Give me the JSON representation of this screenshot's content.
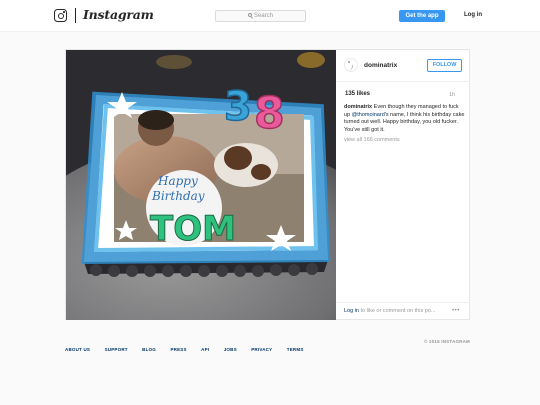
{
  "header": {
    "logo_icon": "instagram-camera-icon",
    "wordmark": "Instagram",
    "search_placeholder": "Search",
    "get_app_label": "Get the app",
    "login_label": "Log in"
  },
  "post": {
    "photo": {
      "description_icon": "photo",
      "cake_text_line1": "Happy",
      "cake_text_line2": "Birthday",
      "cake_name": "TOM",
      "candle_digits": [
        "3",
        "8"
      ]
    },
    "author": "dominatrix",
    "follow_label": "FOLLOW",
    "likes": "135 likes",
    "age": "1h",
    "caption": {
      "author": "dominatrix",
      "text_before": " Even though they managed to fuck up ",
      "mention": "@thomoinard",
      "text_after": "'s name, I think his birthday cake turned out well. Happy birthday, you old fucker. You've still got it."
    },
    "view_all_comments": "view all 166 comments",
    "comment_login_link": "Log in",
    "comment_login_text": " to like or comment on this po...",
    "more_icon": "more-options-icon"
  },
  "footer": {
    "links": [
      "ABOUT US",
      "SUPPORT",
      "BLOG",
      "PRESS",
      "API",
      "JOBS",
      "PRIVACY",
      "TERMS"
    ],
    "copyright": "© 2016 INSTAGRAM"
  },
  "colors": {
    "accent_blue": "#3897f0",
    "link_blue": "#003569",
    "muted": "#999999",
    "page_bg": "#fafafa"
  }
}
